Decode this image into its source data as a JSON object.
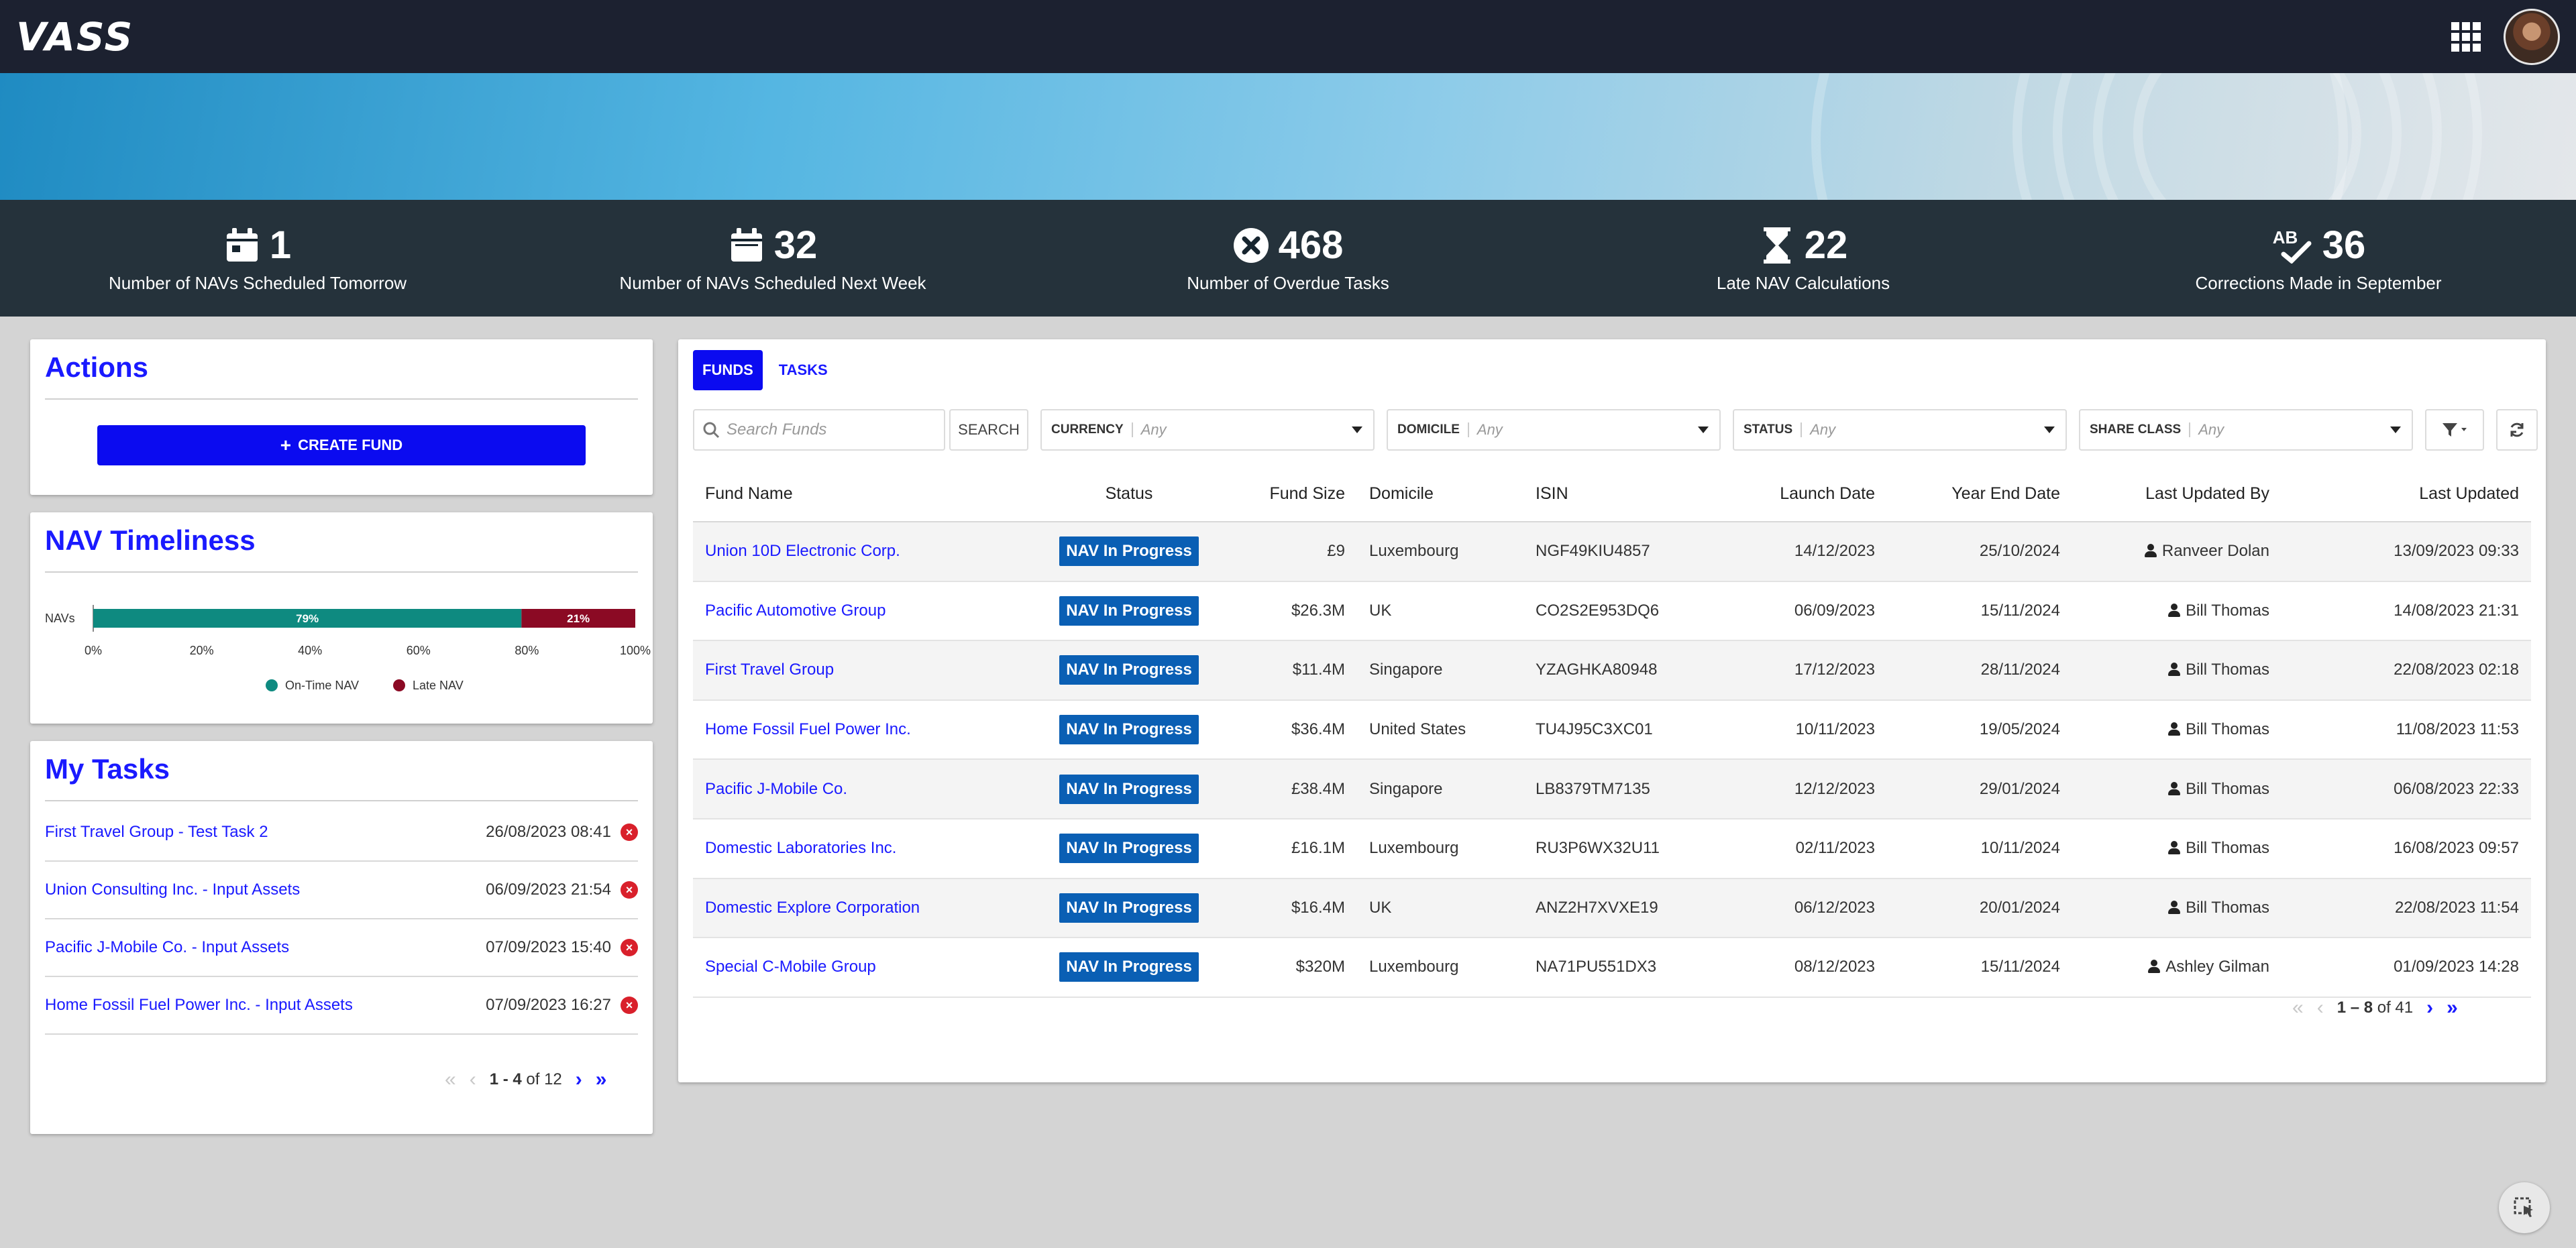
{
  "app": {
    "logo": "VASS"
  },
  "stats": [
    {
      "icon": "calendar-icon",
      "value": "1",
      "label": "Number of NAVs Scheduled Tomorrow"
    },
    {
      "icon": "calendar-icon",
      "value": "32",
      "label": "Number of NAVs Scheduled Next Week"
    },
    {
      "icon": "x-circle-icon",
      "value": "468",
      "label": "Number of Overdue Tasks"
    },
    {
      "icon": "hourglass-icon",
      "value": "22",
      "label": "Late NAV Calculations"
    },
    {
      "icon": "spellcheck-icon",
      "icon_text": "AB",
      "value": "36",
      "label": "Corrections Made in September"
    }
  ],
  "actions": {
    "title": "Actions",
    "create_fund": "CREATE FUND"
  },
  "nav_timeliness": {
    "title": "NAV Timeliness"
  },
  "chart_data": {
    "type": "bar",
    "orientation": "horizontal",
    "stacked": true,
    "categories": [
      "NAVs"
    ],
    "series": [
      {
        "name": "On-Time NAV",
        "values": [
          79
        ],
        "label": "79%",
        "color": "#0e8a80"
      },
      {
        "name": "Late NAV",
        "values": [
          21
        ],
        "label": "21%",
        "color": "#8b0a24"
      }
    ],
    "xticks": [
      "0%",
      "20%",
      "40%",
      "60%",
      "80%",
      "100%"
    ],
    "xlim": [
      0,
      100
    ],
    "legend": "bottom"
  },
  "my_tasks": {
    "title": "My Tasks",
    "items": [
      {
        "name": "First Travel Group - Test Task 2",
        "date": "26/08/2023 08:41"
      },
      {
        "name": "Union Consulting Inc. - Input Assets",
        "date": "06/09/2023 21:54"
      },
      {
        "name": "Pacific J-Mobile Co. - Input Assets",
        "date": "07/09/2023 15:40"
      },
      {
        "name": "Home Fossil Fuel Power Inc. - Input Assets",
        "date": "07/09/2023 16:27"
      }
    ],
    "pager": {
      "range": "1 - 4",
      "of": "of 12"
    }
  },
  "funds": {
    "tabs": [
      "FUNDS",
      "TASKS"
    ],
    "search_placeholder": "Search Funds",
    "search_button": "SEARCH",
    "filters": [
      {
        "label": "CURRENCY",
        "value": "Any"
      },
      {
        "label": "DOMICILE",
        "value": "Any"
      },
      {
        "label": "STATUS",
        "value": "Any"
      },
      {
        "label": "SHARE CLASS",
        "value": "Any"
      }
    ],
    "columns": [
      "Fund Name",
      "Status",
      "Fund Size",
      "Domicile",
      "ISIN",
      "Launch Date",
      "Year End Date",
      "Last Updated By",
      "Last Updated"
    ],
    "rows": [
      [
        "Union 10D Electronic Corp.",
        "NAV In Progress",
        "£9",
        "Luxembourg",
        "NGF49KIU4857",
        "14/12/2023",
        "25/10/2024",
        "Ranveer Dolan",
        "13/09/2023 09:33"
      ],
      [
        "Pacific Automotive Group",
        "NAV In Progress",
        "$26.3M",
        "UK",
        "CO2S2E953DQ6",
        "06/09/2023",
        "15/11/2024",
        "Bill Thomas",
        "14/08/2023 21:31"
      ],
      [
        "First Travel Group",
        "NAV In Progress",
        "$11.4M",
        "Singapore",
        "YZAGHKA80948",
        "17/12/2023",
        "28/11/2024",
        "Bill Thomas",
        "22/08/2023 02:18"
      ],
      [
        "Home Fossil Fuel Power Inc.",
        "NAV In Progress",
        "$36.4M",
        "United States",
        "TU4J95C3XC01",
        "10/11/2023",
        "19/05/2024",
        "Bill Thomas",
        "11/08/2023 11:53"
      ],
      [
        "Pacific J-Mobile Co.",
        "NAV In Progress",
        "£38.4M",
        "Singapore",
        "LB8379TM7135",
        "12/12/2023",
        "29/01/2024",
        "Bill Thomas",
        "06/08/2023 22:33"
      ],
      [
        "Domestic Laboratories Inc.",
        "NAV In Progress",
        "£16.1M",
        "Luxembourg",
        "RU3P6WX32U11",
        "02/11/2023",
        "10/11/2024",
        "Bill Thomas",
        "16/08/2023 09:57"
      ],
      [
        "Domestic Explore Corporation",
        "NAV In Progress",
        "$16.4M",
        "UK",
        "ANZ2H7XVXE19",
        "06/12/2023",
        "20/01/2024",
        "Bill Thomas",
        "22/08/2023 11:54"
      ],
      [
        "Special C-Mobile Group",
        "NAV In Progress",
        "$320M",
        "Luxembourg",
        "NA71PU551DX3",
        "08/12/2023",
        "15/11/2024",
        "Ashley Gilman",
        "01/09/2023 14:28"
      ]
    ],
    "pager": {
      "range": "1 – 8",
      "of": "of 41"
    }
  }
}
